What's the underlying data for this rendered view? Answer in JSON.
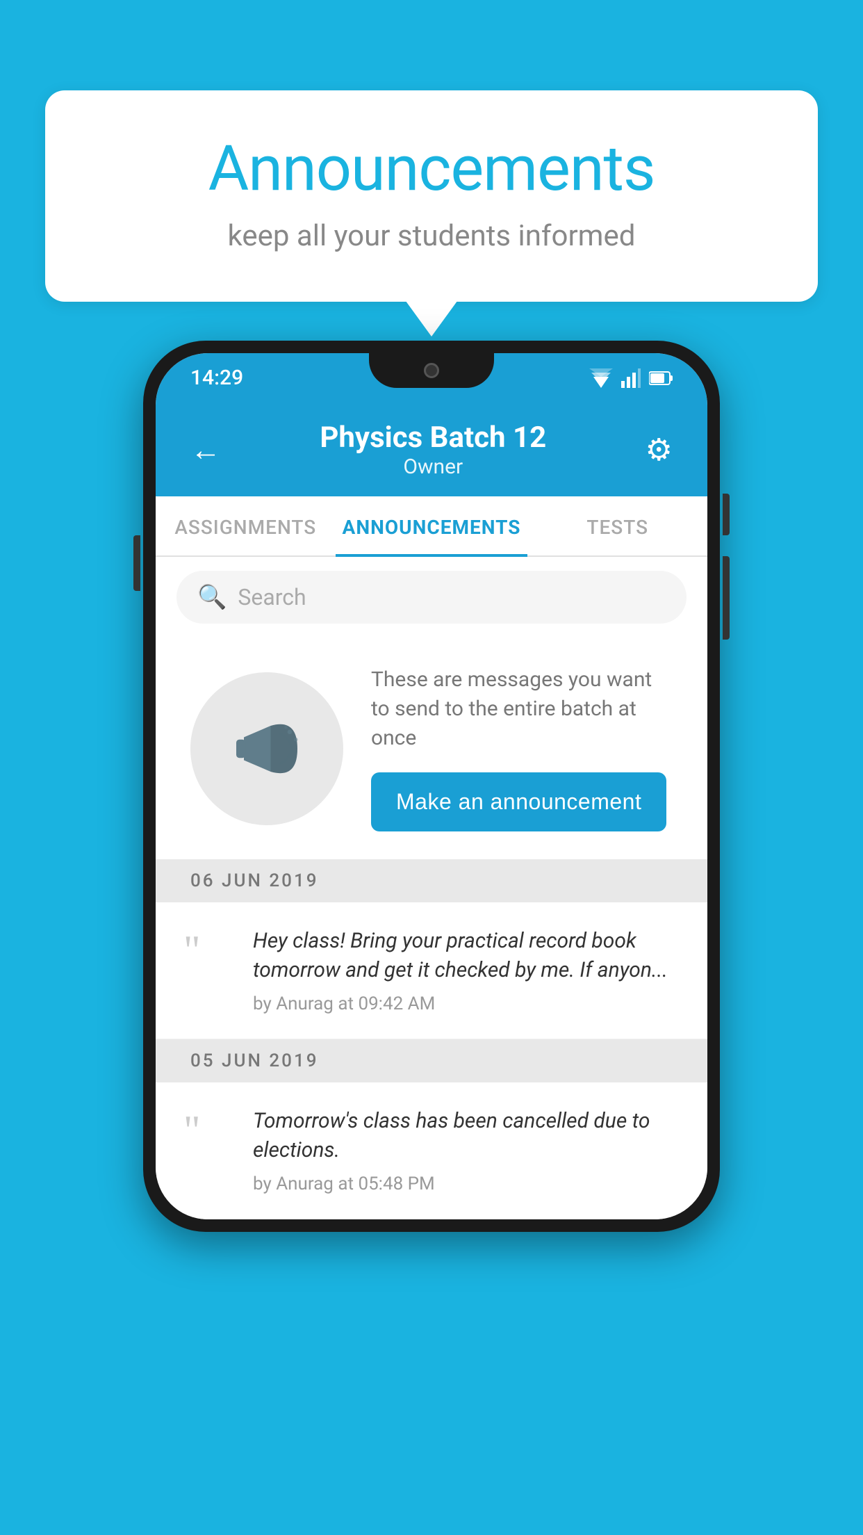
{
  "background_color": "#1ab3e0",
  "speech_bubble": {
    "title": "Announcements",
    "subtitle": "keep all your students informed"
  },
  "phone": {
    "status_bar": {
      "time": "14:29"
    },
    "header": {
      "title": "Physics Batch 12",
      "subtitle": "Owner",
      "back_label": "←",
      "gear_label": "⚙"
    },
    "tabs": [
      {
        "label": "ASSIGNMENTS",
        "active": false
      },
      {
        "label": "ANNOUNCEMENTS",
        "active": true
      },
      {
        "label": "TESTS",
        "active": false
      }
    ],
    "search": {
      "placeholder": "Search"
    },
    "announcement_promo": {
      "description_text": "These are messages you want to send to the entire batch at once",
      "button_label": "Make an announcement"
    },
    "announcements": [
      {
        "date": "06  JUN  2019",
        "text": "Hey class! Bring your practical record book tomorrow and get it checked by me. If anyon...",
        "meta": "by Anurag at 09:42 AM"
      },
      {
        "date": "05  JUN  2019",
        "text": "Tomorrow's class has been cancelled due to elections.",
        "meta": "by Anurag at 05:48 PM"
      }
    ]
  }
}
